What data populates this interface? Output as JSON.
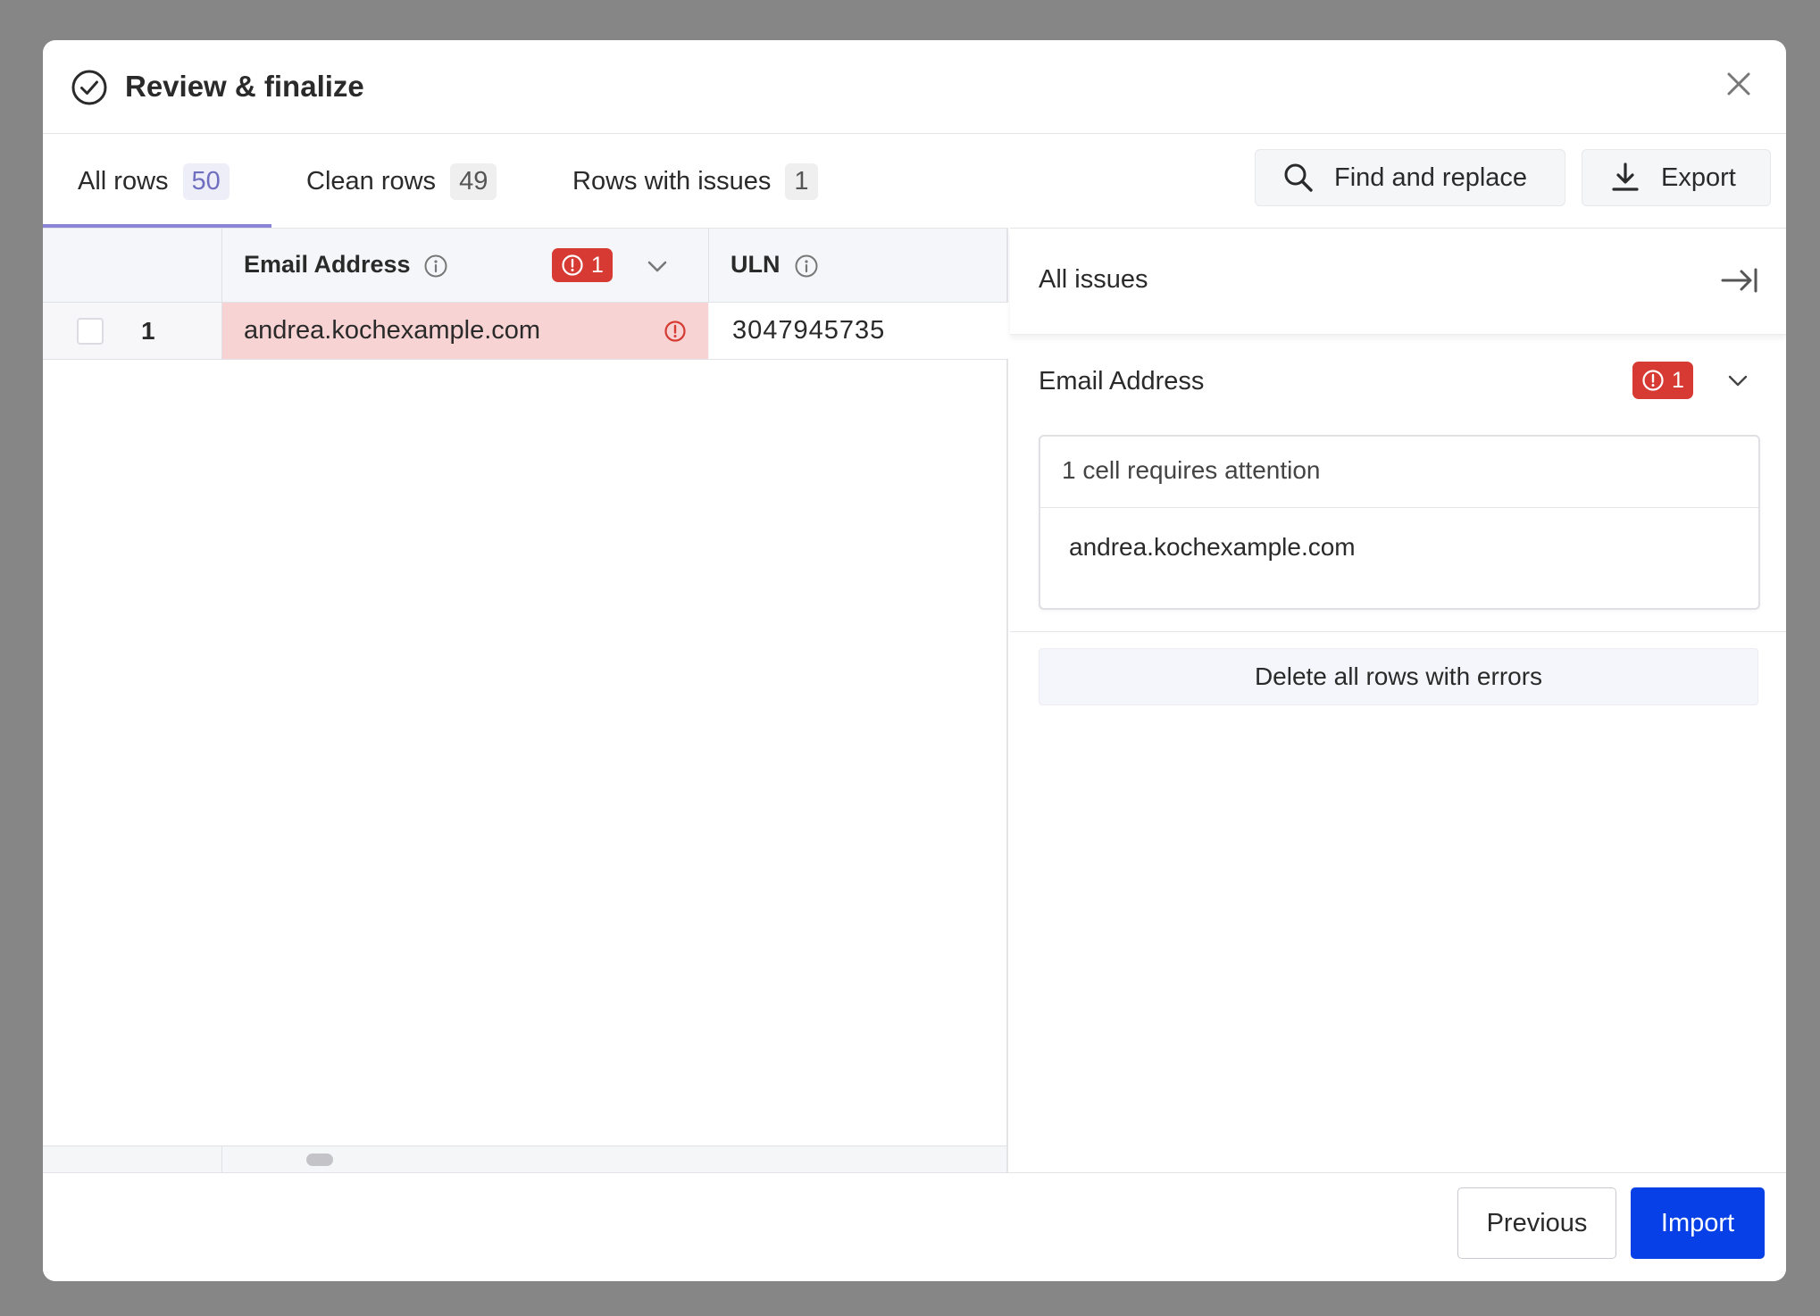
{
  "dialog": {
    "title": "Review & finalize"
  },
  "tabs": [
    {
      "label": "All rows",
      "count": "50",
      "active": true
    },
    {
      "label": "Clean rows",
      "count": "49",
      "active": false
    },
    {
      "label": "Rows with issues",
      "count": "1",
      "active": false
    }
  ],
  "toolbar": {
    "find_replace_label": "Find and replace",
    "export_label": "Export"
  },
  "grid": {
    "columns": [
      {
        "title": "Email Address",
        "error_count": "1"
      },
      {
        "title": "ULN"
      }
    ],
    "rows": [
      {
        "number": "1",
        "email": "andrea.kochexample.com",
        "uln": "3047945735",
        "email_has_error": true
      }
    ]
  },
  "issues_panel": {
    "title": "All issues",
    "group_title": "Email Address",
    "group_error_count": "1",
    "card_heading": "1 cell requires attention",
    "items": [
      "andrea.kochexample.com"
    ],
    "delete_label": "Delete all rows with errors"
  },
  "footer": {
    "previous_label": "Previous",
    "import_label": "Import"
  },
  "colors": {
    "backdrop": "#868686",
    "error": "#d63a32",
    "error_cell": "#f7d3d3",
    "primary": "#0740e6",
    "accent_tab": "#8a84d6"
  },
  "icons": [
    "check-circle-icon",
    "close-icon",
    "search-icon",
    "download-icon",
    "info-icon",
    "alert-circle-icon",
    "chevron-down-icon",
    "collapse-right-icon"
  ]
}
